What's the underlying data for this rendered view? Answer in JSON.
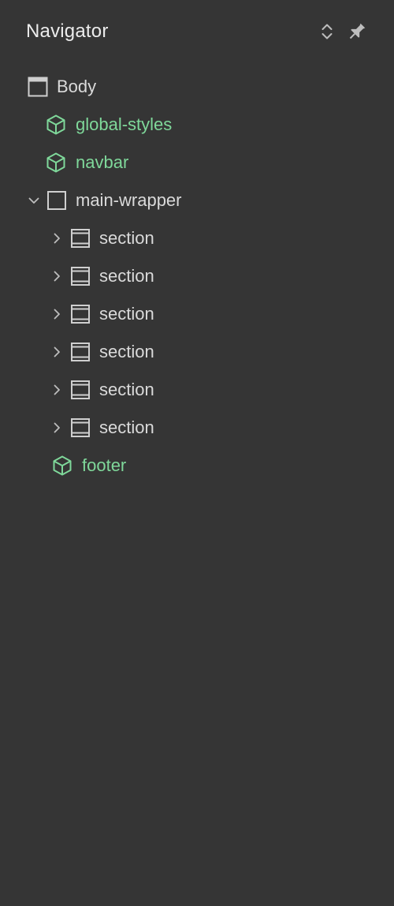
{
  "panel": {
    "title": "Navigator",
    "icons": {
      "expand_collapse": "unfold-icon",
      "pin": "pin-icon"
    }
  },
  "colors": {
    "background": "#353535",
    "text": "#dadada",
    "component": "#7fd89a",
    "icon": "#bdbdbd"
  },
  "tree": [
    {
      "label": "Body",
      "type": "body",
      "depth": 0,
      "expandable": false,
      "expanded": false,
      "icon": "body-icon"
    },
    {
      "label": "global-styles",
      "type": "component",
      "depth": 1,
      "expandable": false,
      "expanded": false,
      "icon": "component-icon"
    },
    {
      "label": "navbar",
      "type": "component",
      "depth": 1,
      "expandable": false,
      "expanded": false,
      "icon": "component-icon"
    },
    {
      "label": "main-wrapper",
      "type": "div",
      "depth": 1,
      "expandable": true,
      "expanded": true,
      "icon": "div-block-icon"
    },
    {
      "label": "section",
      "type": "section",
      "depth": 2,
      "expandable": true,
      "expanded": false,
      "icon": "section-icon"
    },
    {
      "label": "section",
      "type": "section",
      "depth": 2,
      "expandable": true,
      "expanded": false,
      "icon": "section-icon"
    },
    {
      "label": "section",
      "type": "section",
      "depth": 2,
      "expandable": true,
      "expanded": false,
      "icon": "section-icon"
    },
    {
      "label": "section",
      "type": "section",
      "depth": 2,
      "expandable": true,
      "expanded": false,
      "icon": "section-icon"
    },
    {
      "label": "section",
      "type": "section",
      "depth": 2,
      "expandable": true,
      "expanded": false,
      "icon": "section-icon"
    },
    {
      "label": "section",
      "type": "section",
      "depth": 2,
      "expandable": true,
      "expanded": false,
      "icon": "section-icon"
    },
    {
      "label": "footer",
      "type": "component",
      "depth": 2,
      "expandable": false,
      "expanded": false,
      "icon": "component-icon"
    }
  ]
}
